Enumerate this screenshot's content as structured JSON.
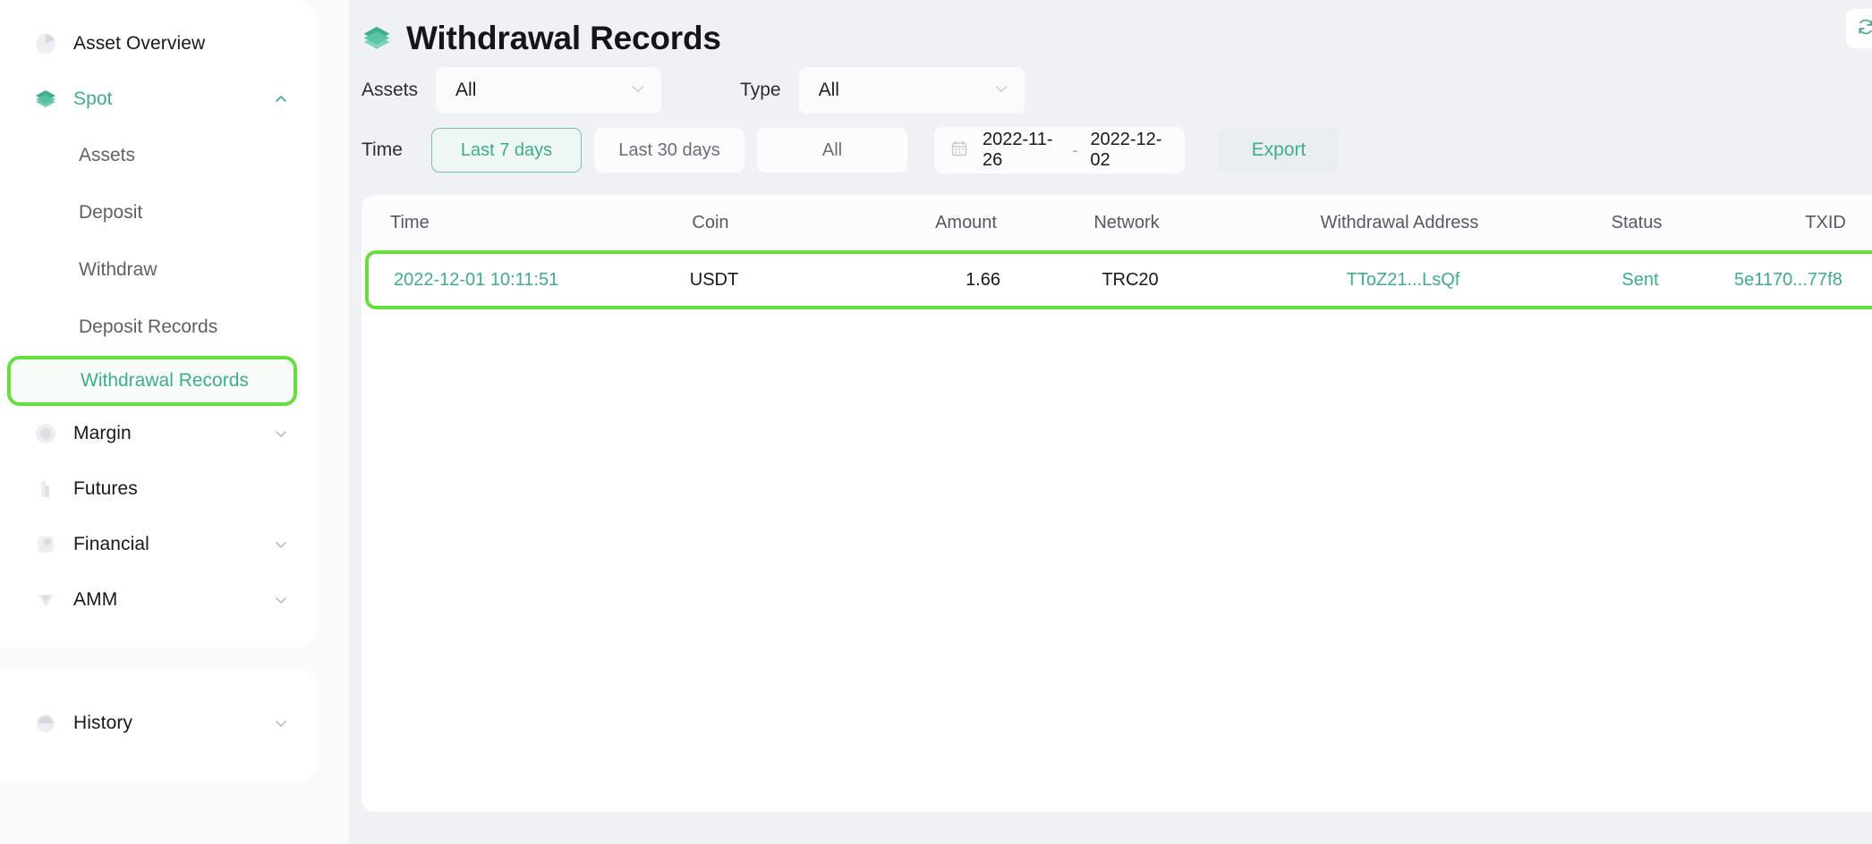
{
  "sidebar": {
    "primary_items": [
      {
        "label": "Asset Overview",
        "icon": "pie-chart-icon",
        "expandable": false,
        "active": false
      },
      {
        "label": "Spot",
        "icon": "layers-icon",
        "expandable": true,
        "active": true
      },
      {
        "label": "Margin",
        "icon": "margin-icon",
        "expandable": true,
        "active": false
      },
      {
        "label": "Futures",
        "icon": "futures-icon",
        "expandable": false,
        "active": false
      },
      {
        "label": "Financial",
        "icon": "financial-icon",
        "expandable": true,
        "active": false
      },
      {
        "label": "AMM",
        "icon": "amm-icon",
        "expandable": true,
        "active": false
      }
    ],
    "spot_children": [
      {
        "label": "Assets",
        "active": false
      },
      {
        "label": "Deposit",
        "active": false
      },
      {
        "label": "Withdraw",
        "active": false
      },
      {
        "label": "Deposit Records",
        "active": false
      },
      {
        "label": "Withdrawal Records",
        "active": true
      }
    ],
    "secondary_items": [
      {
        "label": "History",
        "icon": "history-icon",
        "expandable": true,
        "active": false
      }
    ]
  },
  "header": {
    "title": "Withdrawal Records",
    "icon": "layers-icon",
    "refresh_icon": "refresh-icon"
  },
  "filters": {
    "assets": {
      "label": "Assets",
      "value": "All",
      "caret_icon": "chevron-down-icon"
    },
    "type": {
      "label": "Type",
      "value": "All",
      "caret_icon": "chevron-down-icon"
    },
    "time": {
      "label": "Time",
      "ranges": [
        {
          "label": "Last 7 days",
          "selected": true
        },
        {
          "label": "Last 30 days",
          "selected": false
        },
        {
          "label": "All",
          "selected": false
        }
      ],
      "date_from": "2022-11-26",
      "date_to": "2022-12-02",
      "date_separator": "-",
      "calendar_icon": "calendar-icon"
    },
    "export_label": "Export"
  },
  "table": {
    "columns": [
      "Time",
      "Coin",
      "Amount",
      "Network",
      "Withdrawal Address",
      "Status",
      "TXID"
    ],
    "rows": [
      {
        "time": "2022-12-01 10:11:51",
        "coin": "USDT",
        "amount": "1.66",
        "network": "TRC20",
        "address": "TToZ21...LsQf",
        "status": "Sent",
        "txid": "5e1170...77f8",
        "highlighted": true
      }
    ]
  },
  "colors": {
    "accent_teal": "#3cae8d",
    "annotation_green": "#63e03a",
    "page_bg": "#eff1f5",
    "card_bg": "#fbfcfd",
    "text_primary": "#16181d",
    "text_muted": "#5d6166"
  }
}
